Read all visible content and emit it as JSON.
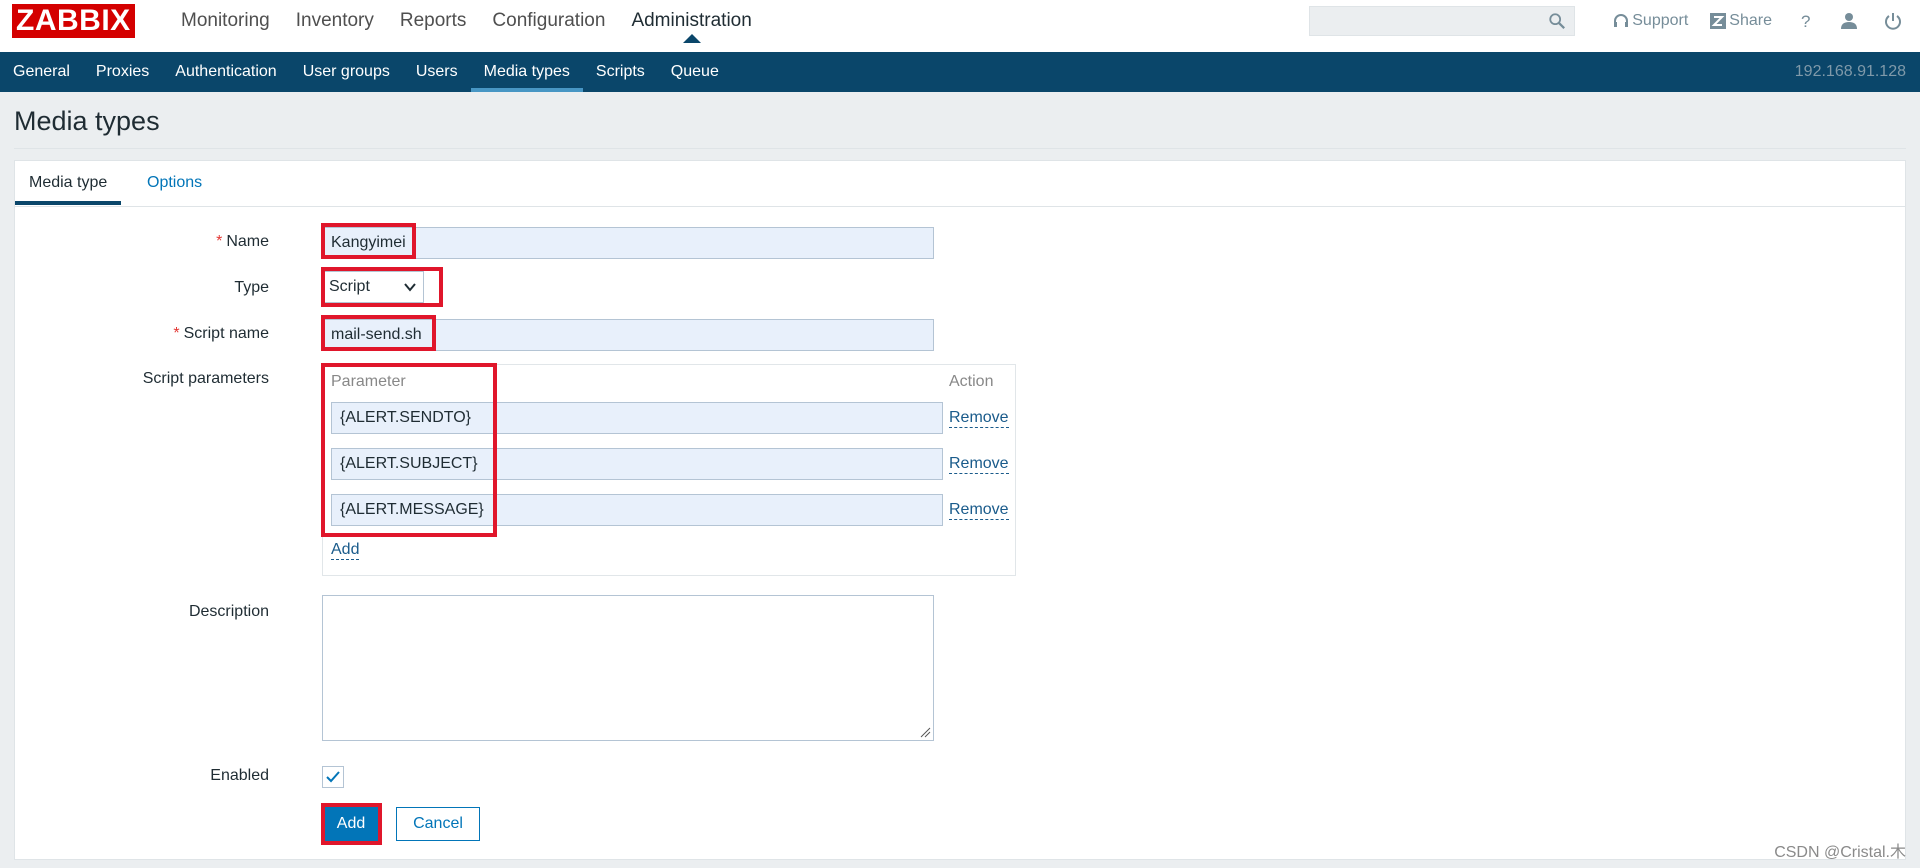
{
  "app": {
    "logo": "ZABBIX",
    "ip": "192.168.91.128"
  },
  "main_nav": [
    "Monitoring",
    "Inventory",
    "Reports",
    "Configuration",
    "Administration"
  ],
  "main_nav_active": "Administration",
  "search": {
    "value": "",
    "placeholder": ""
  },
  "top_links": {
    "support": "Support",
    "share": "Share"
  },
  "sub_nav": [
    "General",
    "Proxies",
    "Authentication",
    "User groups",
    "Users",
    "Media types",
    "Scripts",
    "Queue"
  ],
  "sub_nav_active": "Media types",
  "page": {
    "title": "Media types"
  },
  "tabs": {
    "media_type": "Media type",
    "options": "Options"
  },
  "form": {
    "name_label": "Name",
    "name_value": "Kangyimei",
    "type_label": "Type",
    "type_value": "Script",
    "script_name_label": "Script name",
    "script_name_value": "mail-send.sh",
    "script_params_label": "Script parameters",
    "params_header_parameter": "Parameter",
    "params_header_action": "Action",
    "params": [
      "{ALERT.SENDTO}",
      "{ALERT.SUBJECT}",
      "{ALERT.MESSAGE}"
    ],
    "remove_label": "Remove",
    "add_param_label": "Add",
    "description_label": "Description",
    "description_value": "",
    "enabled_label": "Enabled",
    "enabled": true,
    "add_button": "Add",
    "cancel_button": "Cancel"
  },
  "watermark": "CSDN @Cristal.木",
  "colors": {
    "brand": "#d40000",
    "nav": "#0a466a",
    "accent": "#0275b8",
    "highlight": "#e0162b"
  }
}
